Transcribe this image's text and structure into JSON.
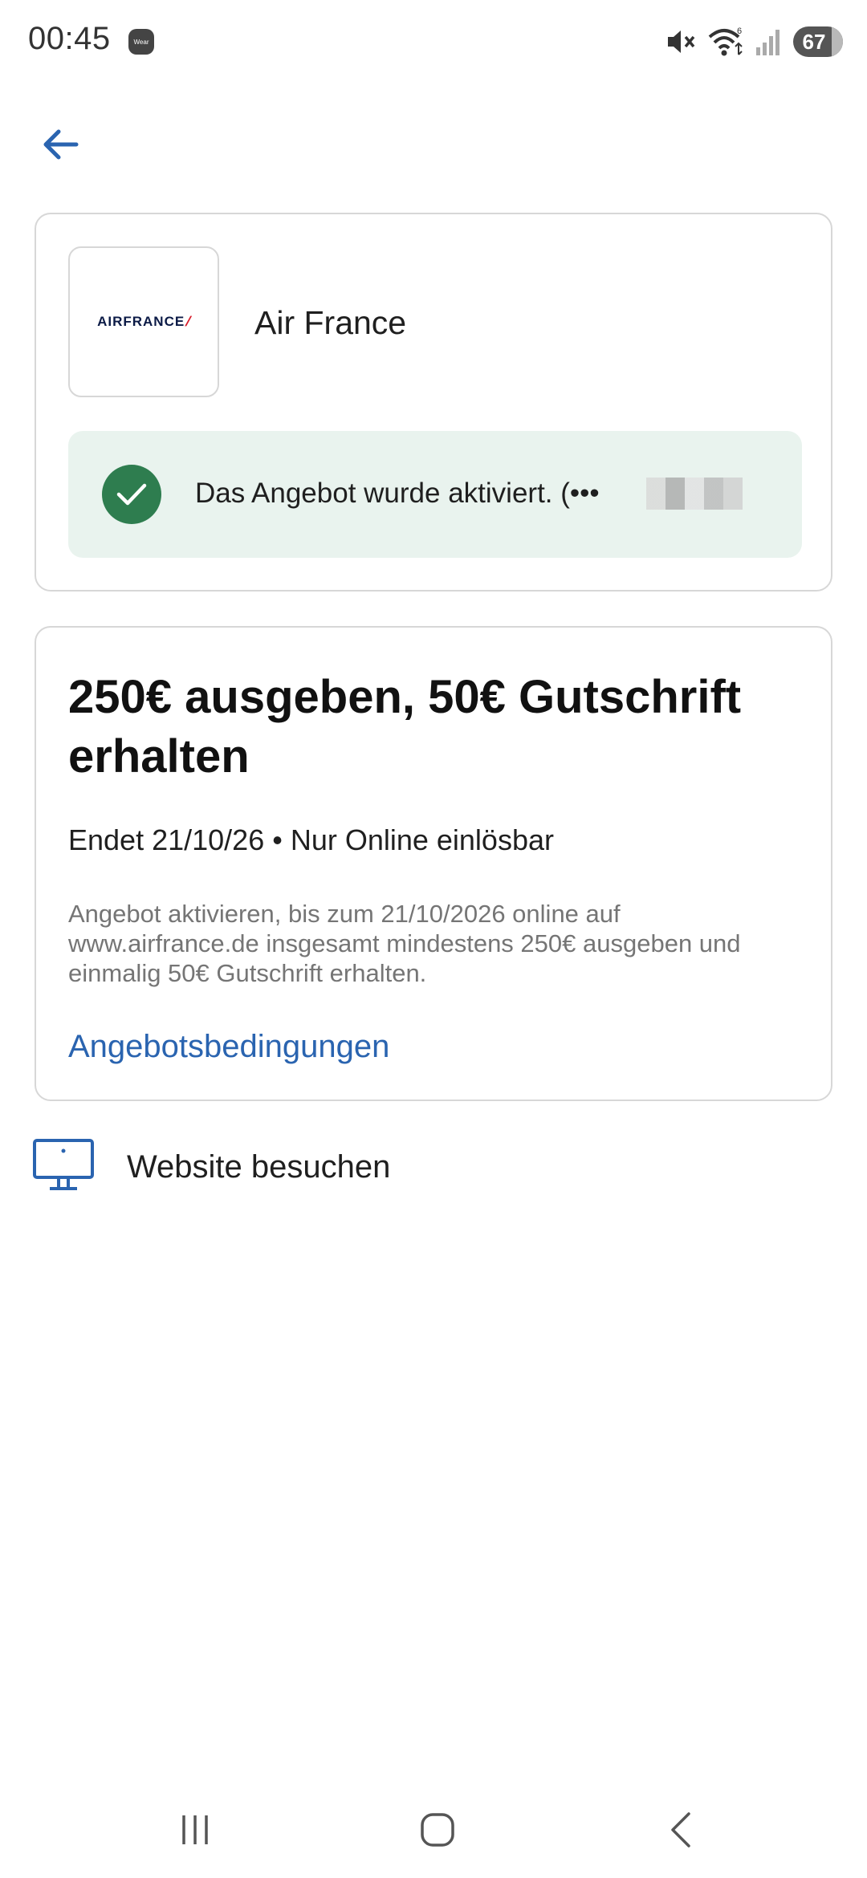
{
  "status_bar": {
    "time": "00:45",
    "wear_label": "Wear",
    "battery": "67"
  },
  "merchant": {
    "logo_text": "AIRFRANCE",
    "name": "Air France",
    "activated_message": "Das Angebot wurde aktiviert. (•••"
  },
  "offer": {
    "title": "250€ ausgeben, 50€ Gutschrift erhalten",
    "meta": "Endet 21/10/26 • Nur Online einlösbar",
    "description": "Angebot aktivieren, bis zum 21/10/2026 online auf www.airfrance.de insgesamt mindestens 250€ ausgeben und einmalig 50€ Gutschrift erhalten.",
    "terms_link": "Angebotsbedingungen"
  },
  "website": {
    "label": "Website besuchen"
  },
  "colors": {
    "accent": "#2a64b0",
    "success": "#2e7d4f",
    "banner_bg": "#e9f3ee"
  },
  "icons": [
    "back-arrow-icon",
    "check-icon",
    "monitor-icon",
    "mute-icon",
    "wifi-icon",
    "signal-icon",
    "recent-apps-icon",
    "home-icon",
    "nav-back-icon"
  ]
}
